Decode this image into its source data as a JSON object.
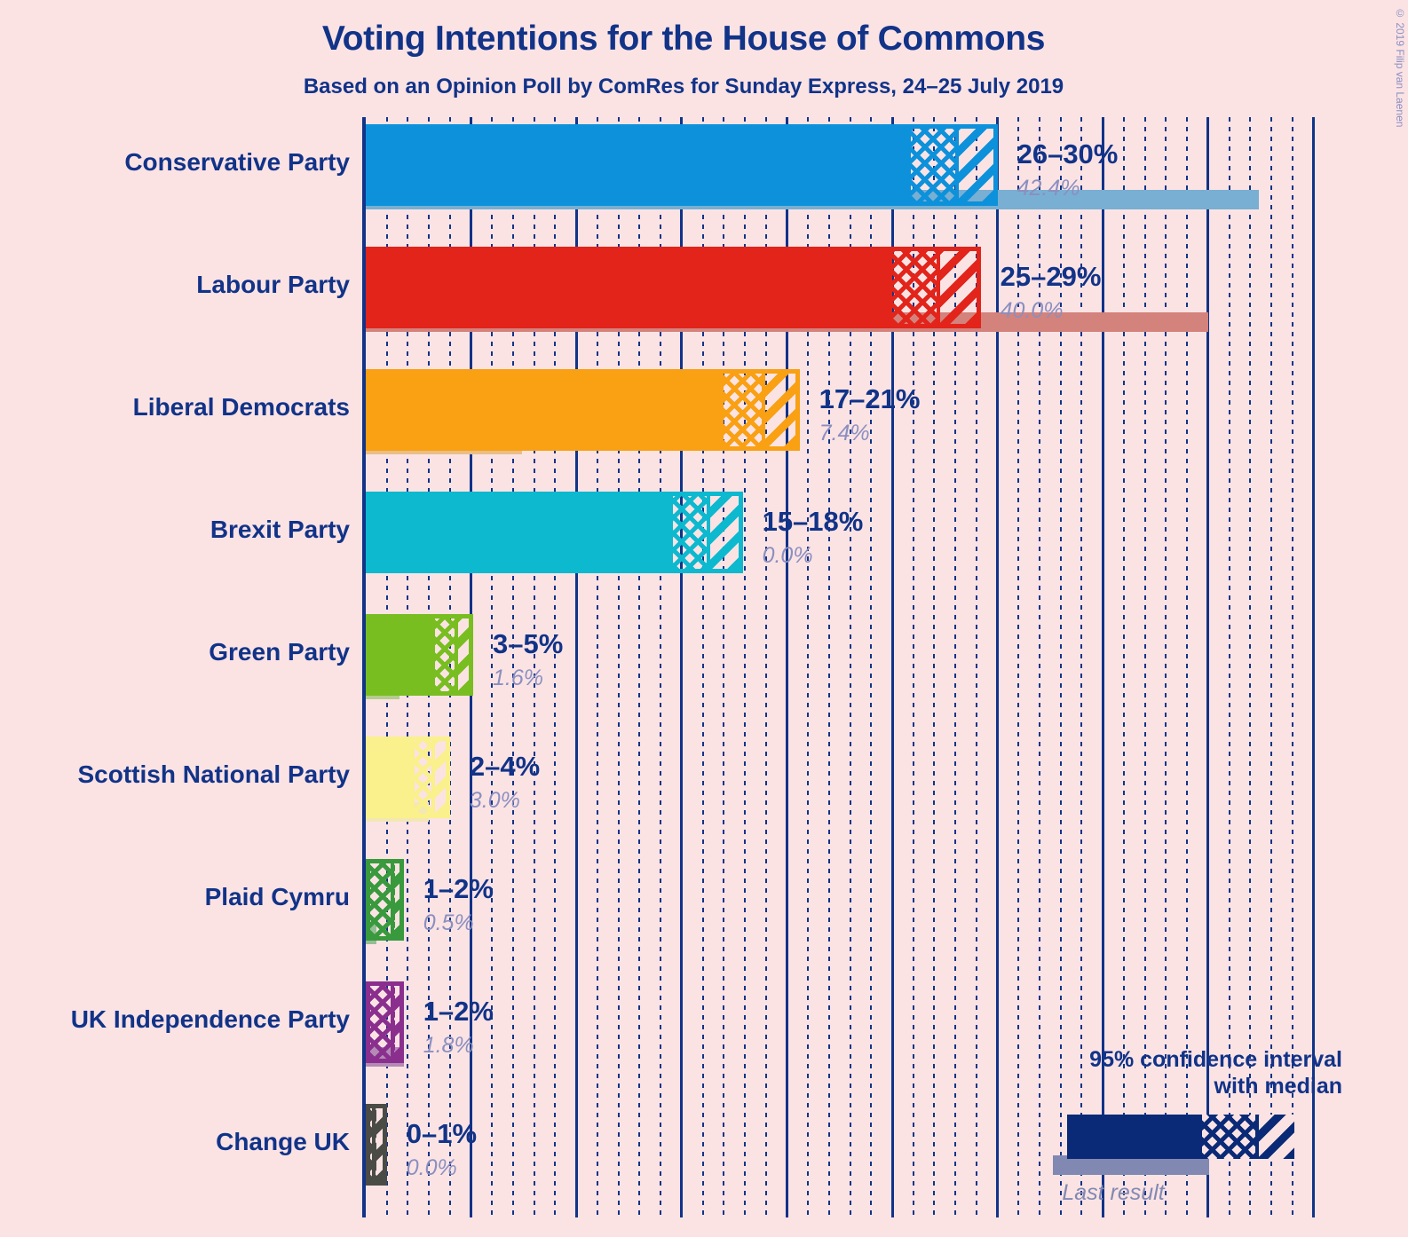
{
  "header": {
    "title": "Voting Intentions for the House of Commons",
    "subtitle": "Based on an Opinion Poll by ComRes for Sunday Express, 24–25 July 2019",
    "copyright": "© 2019 Filip van Laenen"
  },
  "legend": {
    "line1": "95% confidence interval",
    "line2": "with median",
    "caption": "Last result",
    "swatch_color": "#0A2A77",
    "last_color": "#8189B2"
  },
  "colors": {
    "background": "#FBE3E4",
    "text": "#113388",
    "muted_text": "#8B8FC0",
    "grid": "#113388"
  },
  "chart_data": {
    "type": "bar",
    "title": "Voting Intentions for the House of Commons",
    "subtitle": "Based on an Opinion Poll by ComRes for Sunday Express, 24–25 July 2019",
    "orientation": "horizontal",
    "xlabel": "",
    "ylabel": "",
    "xlim": [
      0,
      45
    ],
    "x_major_tick": 5,
    "x_minor_tick": 1,
    "grid": true,
    "legend_position": "bottom-right",
    "value_unit": "%",
    "series_description": "95% confidence interval with median, and last election result",
    "categories": [
      "Conservative Party",
      "Labour Party",
      "Liberal Democrats",
      "Brexit Party",
      "Green Party",
      "Scottish National Party",
      "Plaid Cymru",
      "UK Independence Party",
      "Change UK"
    ],
    "parties": [
      {
        "name": "Conservative Party",
        "ci_label": "26–30%",
        "last_label": "42.4%",
        "ci_low": 25.9,
        "ci_median": 28.0,
        "ci_high": 30.0,
        "last_result": 42.4,
        "color": "#0D91DB",
        "last_color": "#78AFD2"
      },
      {
        "name": "Labour Party",
        "ci_label": "25–29%",
        "last_label": "40.0%",
        "ci_low": 25.0,
        "ci_median": 27.1,
        "ci_high": 29.2,
        "last_result": 40.0,
        "color": "#E2241B",
        "last_color": "#D4827C"
      },
      {
        "name": "Liberal Democrats",
        "ci_label": "17–21%",
        "last_label": "7.4%",
        "ci_low": 17.0,
        "ci_median": 18.8,
        "ci_high": 20.6,
        "last_result": 7.4,
        "color": "#F9A013",
        "last_color": "#E9BE87"
      },
      {
        "name": "Brexit Party",
        "ci_label": "15–18%",
        "last_label": "0.0%",
        "ci_low": 14.6,
        "ci_median": 16.2,
        "ci_high": 17.9,
        "last_result": 0.0,
        "color": "#0CB9CF",
        "last_color": "#85CCD6"
      },
      {
        "name": "Green Party",
        "ci_label": "3–5%",
        "last_label": "1.6%",
        "ci_low": 3.3,
        "ci_median": 4.2,
        "ci_high": 5.1,
        "last_result": 1.6,
        "color": "#78BE20",
        "last_color": "#B4CC8E"
      },
      {
        "name": "Scottish National Party",
        "ci_label": "2–4%",
        "last_label": "3.0%",
        "ci_low": 2.3,
        "ci_median": 3.1,
        "ci_high": 4.0,
        "last_result": 3.0,
        "color": "#FAF08C",
        "last_color": "#F3E7B4"
      },
      {
        "name": "Plaid Cymru",
        "ci_label": "1–2%",
        "last_label": "0.5%",
        "ci_low": 0.0,
        "ci_median": 1.2,
        "ci_high": 1.8,
        "last_result": 0.5,
        "color": "#389A3C",
        "last_color": "#96BE96"
      },
      {
        "name": "UK Independence Party",
        "ci_label": "1–2%",
        "last_label": "1.8%",
        "ci_low": 0.0,
        "ci_median": 1.2,
        "ci_high": 1.8,
        "last_result": 1.8,
        "color": "#8B2F8F",
        "last_color": "#B38BB5"
      },
      {
        "name": "Change UK",
        "ci_label": "0–1%",
        "last_label": "0.0%",
        "ci_low": 0.0,
        "ci_median": 0.3,
        "ci_high": 1.0,
        "last_result": 0.0,
        "color": "#4B4B45",
        "last_color": "#A0A098"
      }
    ]
  }
}
